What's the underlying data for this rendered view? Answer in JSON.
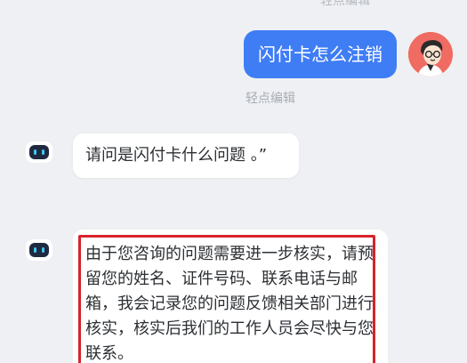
{
  "top_hint": "轻点编辑",
  "conversation": {
    "user_message": {
      "text": "闪付卡怎么注销",
      "edit_hint": "轻点编辑"
    },
    "bot_messages": [
      {
        "text": "请问是闪付卡什么问题 。”"
      },
      {
        "text": "由于您咨询的问题需要进一步核实，请预留您的姓名、证件号码、联系电话与邮箱，我会记录您的问题反馈相关部门进行核实，核实后我们的工作人员会尽快与您联系。"
      }
    ]
  },
  "icons": {
    "user_avatar": "cartoon-person-avatar-icon",
    "bot_avatar": "robot-head-icon"
  },
  "colors": {
    "background": "#eef0f3",
    "user_bubble": "#3f7df5",
    "bot_bubble": "#ffffff",
    "highlight": "#d8232a",
    "hint_text": "#a8adb5"
  }
}
